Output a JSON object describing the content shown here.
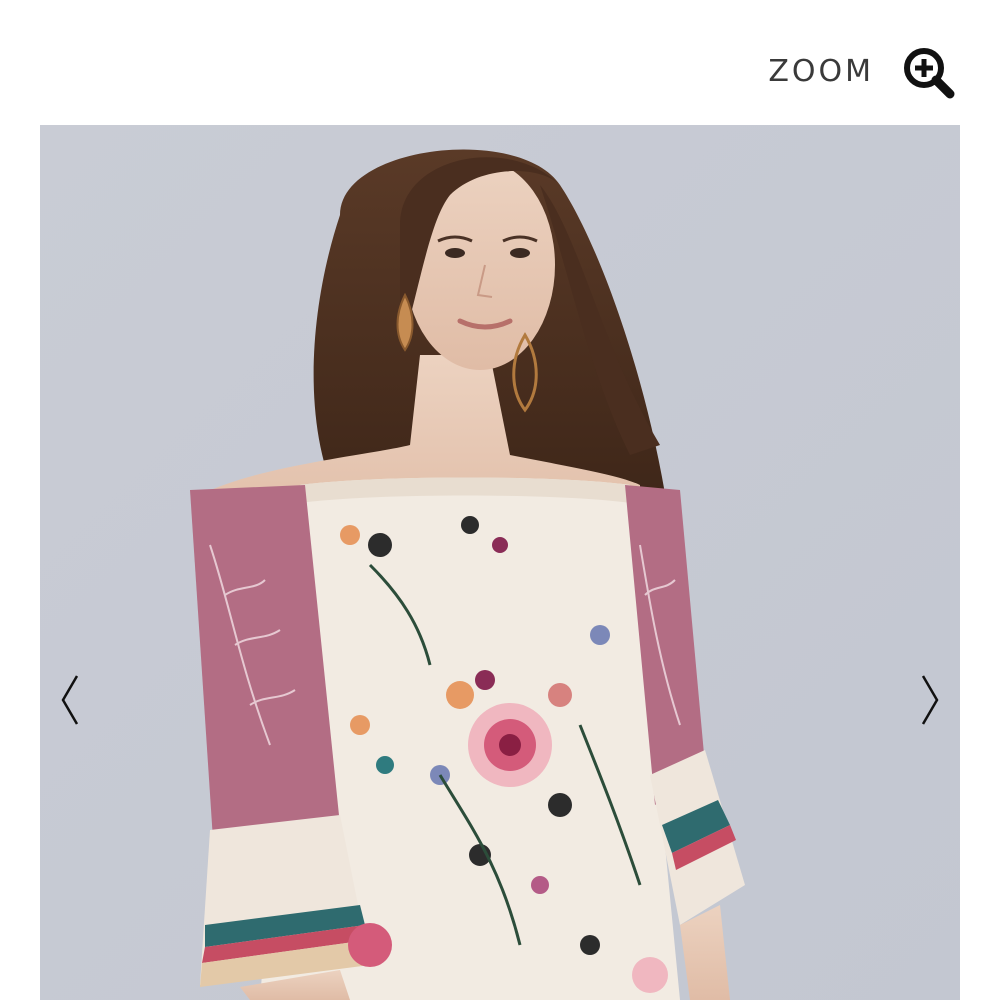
{
  "zoom": {
    "label": "ZOOM",
    "icon": "zoom-in-icon"
  },
  "gallery": {
    "prev_icon": "chevron-left-icon",
    "next_icon": "chevron-right-icon",
    "background_color": "#c8ccd6"
  }
}
